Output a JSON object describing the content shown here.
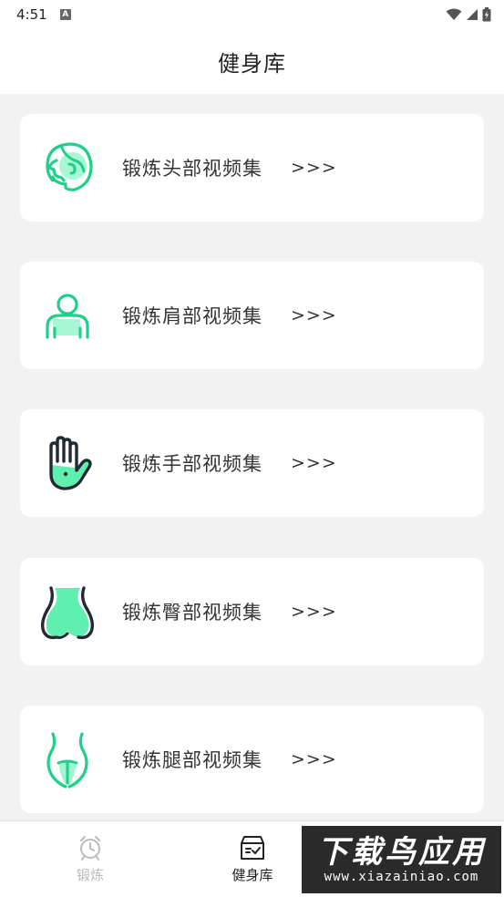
{
  "status_bar": {
    "time": "4:51",
    "notification_badge": "A",
    "icons": [
      "wifi-icon",
      "signal-icon",
      "battery-icon"
    ]
  },
  "header": {
    "title": "健身库"
  },
  "cards": [
    {
      "label": "锻炼头部视频集",
      "arrow": ">>>",
      "icon": "head-icon"
    },
    {
      "label": "锻炼肩部视频集",
      "arrow": ">>>",
      "icon": "shoulder-icon"
    },
    {
      "label": "锻炼手部视频集",
      "arrow": ">>>",
      "icon": "hand-icon"
    },
    {
      "label": "锻炼臀部视频集",
      "arrow": ">>>",
      "icon": "hip-icon"
    },
    {
      "label": "锻炼腿部视频集",
      "arrow": ">>>",
      "icon": "leg-icon"
    }
  ],
  "tabbar": {
    "tabs": [
      {
        "label": "锻炼",
        "icon": "alarm-clock-icon",
        "active": false
      },
      {
        "label": "健身库",
        "icon": "archive-box-icon",
        "active": true
      }
    ]
  },
  "watermark": {
    "main": "下载鸟应用",
    "sub": "www.xiazainiao.com"
  },
  "colors": {
    "accent": "#1fcf8a",
    "accent_light": "#5ff0b0",
    "dark_outline": "#222a33",
    "background": "#f2f2f2"
  }
}
